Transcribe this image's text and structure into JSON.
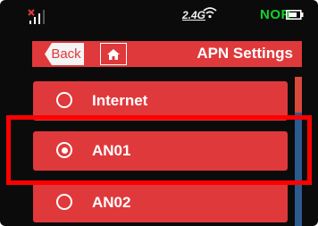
{
  "status_bar": {
    "network_type": "2.4G",
    "mode": "NOR"
  },
  "header": {
    "back_label": "Back",
    "title": "APN Settings"
  },
  "apn_list": [
    {
      "label": "Internet",
      "selected": false
    },
    {
      "label": "AN01",
      "selected": true
    },
    {
      "label": "AN02",
      "selected": false
    }
  ],
  "colors": {
    "accent": "#e0393b",
    "mode_text": "#12d12a",
    "highlight": "#ff0000",
    "scroll_track": "#2c5a8f"
  }
}
